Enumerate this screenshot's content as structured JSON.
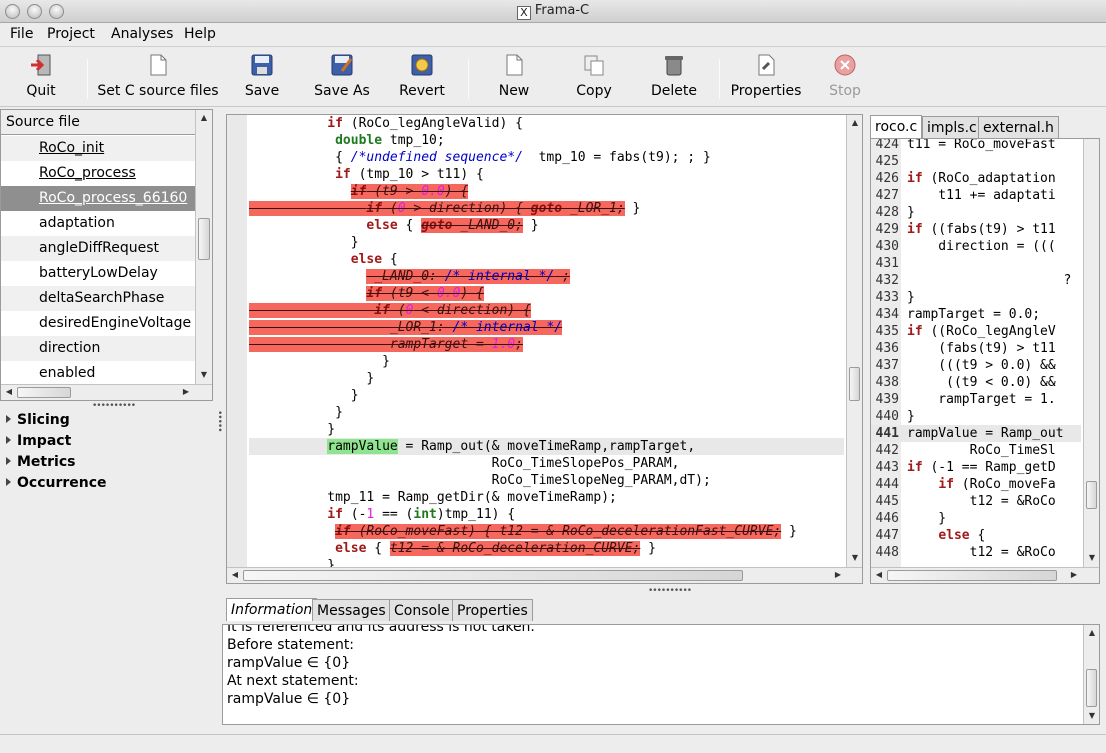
{
  "window": {
    "title": "Frama-C"
  },
  "menu": [
    "File",
    "Project",
    "Analyses",
    "Help"
  ],
  "toolbar": {
    "quit": "Quit",
    "set_sources": "Set C source files",
    "save": "Save",
    "save_as": "Save As",
    "revert": "Revert",
    "new": "New",
    "copy": "Copy",
    "delete": "Delete",
    "properties": "Properties",
    "stop": "Stop"
  },
  "file_panel": {
    "header": "Source file",
    "items": [
      "RoCo_init",
      "RoCo_process",
      "RoCo_process_66160",
      "adaptation",
      "angleDiffRequest",
      "batteryLowDelay",
      "deltaSearchPhase",
      "desiredEngineVoltage",
      "direction",
      "enabled"
    ],
    "selected_index": 2
  },
  "plugins": [
    "Slicing",
    "Impact",
    "Metrics",
    "Occurrence"
  ],
  "code": {
    "lines": [
      {
        "indent": "          ",
        "segs": [
          [
            "kw",
            "if"
          ],
          [
            "",
            " (RoCo_legAngleValid) {"
          ]
        ]
      },
      {
        "indent": "           ",
        "segs": [
          [
            "ty",
            "double"
          ],
          [
            "",
            " tmp_10;"
          ]
        ]
      },
      {
        "indent": "           ",
        "segs": [
          [
            "",
            "{ "
          ],
          [
            "cm",
            "/*undefined sequence*/"
          ],
          [
            "",
            "  tmp_10 = fabs(t9); ; }"
          ]
        ]
      },
      {
        "indent": "           ",
        "segs": [
          [
            "kw",
            "if"
          ],
          [
            "",
            " (tmp_10 > t11) {"
          ]
        ]
      },
      {
        "indent": "             ",
        "segs": [
          [
            "dead-kw",
            "if"
          ],
          [
            "dead",
            " (t9 > "
          ],
          [
            "dead-num",
            "0.0"
          ],
          [
            "dead",
            ") {"
          ]
        ]
      },
      {
        "indent": "",
        "segs": [
          [
            "dead",
            "               "
          ],
          [
            "dead-kw",
            "if"
          ],
          [
            "dead",
            " ("
          ],
          [
            "dead-num",
            "0"
          ],
          [
            "dead",
            " > direction) { "
          ],
          [
            "dead-kw",
            "goto"
          ],
          [
            "dead",
            " _LOR_1;"
          ],
          [
            "",
            " }"
          ]
        ]
      },
      {
        "indent": "               ",
        "segs": [
          [
            "kw",
            "else"
          ],
          [
            "",
            " { "
          ],
          [
            "dead-kw",
            "goto"
          ],
          [
            "dead",
            " _LAND_0;"
          ],
          [
            "",
            " }"
          ]
        ]
      },
      {
        "indent": "             ",
        "segs": [
          [
            "",
            "}"
          ]
        ]
      },
      {
        "indent": "             ",
        "segs": [
          [
            "kw",
            "else"
          ],
          [
            "",
            " {"
          ]
        ]
      },
      {
        "indent": "               ",
        "segs": [
          [
            "dead",
            " _LAND_0: "
          ],
          [
            "dead-cm",
            "/* internal */"
          ],
          [
            "dead",
            " ;"
          ]
        ]
      },
      {
        "indent": "               ",
        "segs": [
          [
            "dead-kw",
            "if"
          ],
          [
            "dead",
            " (t9 < "
          ],
          [
            "dead-num",
            "0.0"
          ],
          [
            "dead",
            ") {"
          ]
        ]
      },
      {
        "indent": "",
        "segs": [
          [
            "dead",
            "                "
          ],
          [
            "dead-kw",
            "if"
          ],
          [
            "dead",
            " ("
          ],
          [
            "dead-num",
            "0"
          ],
          [
            "dead",
            " < direction) {"
          ]
        ]
      },
      {
        "indent": "",
        "segs": [
          [
            "dead",
            "                  _LOR_1: "
          ],
          [
            "dead-cm",
            "/* internal */"
          ]
        ]
      },
      {
        "indent": "",
        "segs": [
          [
            "dead",
            "                  rampTarget = "
          ],
          [
            "dead-num",
            "1.0"
          ],
          [
            "dead",
            ";"
          ]
        ]
      },
      {
        "indent": "                 ",
        "segs": [
          [
            "",
            "}"
          ]
        ]
      },
      {
        "indent": "               ",
        "segs": [
          [
            "",
            "}"
          ]
        ]
      },
      {
        "indent": "             ",
        "segs": [
          [
            "",
            "}"
          ]
        ]
      },
      {
        "indent": "           ",
        "segs": [
          [
            "",
            "}"
          ]
        ]
      },
      {
        "indent": "          ",
        "segs": [
          [
            "",
            "}"
          ]
        ]
      },
      {
        "indent": "          ",
        "hl": true,
        "segs": [
          [
            "green",
            "rampValue"
          ],
          [
            "",
            " = Ramp_out(& moveTimeRamp,rampTarget,"
          ]
        ]
      },
      {
        "indent": "                               ",
        "segs": [
          [
            "",
            "RoCo_TimeSlopePos_PARAM,"
          ]
        ]
      },
      {
        "indent": "                               ",
        "segs": [
          [
            "",
            "RoCo_TimeSlopeNeg_PARAM,dT);"
          ]
        ]
      },
      {
        "indent": "          ",
        "segs": [
          [
            "",
            "tmp_11 = Ramp_getDir(& moveTimeRamp);"
          ]
        ]
      },
      {
        "indent": "          ",
        "segs": [
          [
            "kw",
            "if"
          ],
          [
            "",
            " (-"
          ],
          [
            "num",
            "1"
          ],
          [
            "",
            " == ("
          ],
          [
            "ty",
            "int"
          ],
          [
            "",
            ")tmp_11) {"
          ]
        ]
      },
      {
        "indent": "           ",
        "segs": [
          [
            "dead-kw",
            "if"
          ],
          [
            "dead",
            " (RoCo_moveFast) { t12 = & RoCo_decelerationFast_CURVE;"
          ],
          [
            "",
            " }"
          ]
        ]
      },
      {
        "indent": "           ",
        "segs": [
          [
            "kw",
            "else"
          ],
          [
            "",
            " { "
          ],
          [
            "dead",
            "t12 = & RoCo_deceleration_CURVE;"
          ],
          [
            "",
            " }"
          ]
        ]
      },
      {
        "indent": "          ",
        "segs": [
          [
            "",
            "}"
          ]
        ]
      }
    ]
  },
  "right_tabs": [
    "roco.c",
    "impls.c",
    "external.h"
  ],
  "right_code": {
    "lines": [
      {
        "n": "424",
        "t": "t11 = RoCo_moveFast"
      },
      {
        "n": "425",
        "t": ""
      },
      {
        "n": "426",
        "t": "if (RoCo_adaptation"
      },
      {
        "n": "427",
        "t": "    t11 += adaptati"
      },
      {
        "n": "428",
        "t": "}"
      },
      {
        "n": "429",
        "t": "if ((fabs(t9) > t11"
      },
      {
        "n": "430",
        "t": "    direction = ((("
      },
      {
        "n": "431",
        "t": ""
      },
      {
        "n": "432",
        "t": "                    ?"
      },
      {
        "n": "433",
        "t": "}"
      },
      {
        "n": "434",
        "t": "rampTarget = 0.0;"
      },
      {
        "n": "435",
        "t": "if ((RoCo_legAngleV"
      },
      {
        "n": "436",
        "t": "    (fabs(t9) > t11"
      },
      {
        "n": "437",
        "t": "    (((t9 > 0.0) &&"
      },
      {
        "n": "438",
        "t": "     ((t9 < 0.0) &&"
      },
      {
        "n": "439",
        "t": "    rampTarget = 1."
      },
      {
        "n": "440",
        "t": "}"
      },
      {
        "n": "441",
        "t": "rampValue = Ramp_out"
      },
      {
        "n": "442",
        "t": "        RoCo_TimeSl"
      },
      {
        "n": "443",
        "t": "if (-1 == Ramp_getD"
      },
      {
        "n": "444",
        "t": "    if (RoCo_moveFa"
      },
      {
        "n": "445",
        "t": "        t12 = &RoCo"
      },
      {
        "n": "446",
        "t": "    }"
      },
      {
        "n": "447",
        "t": "    else {"
      },
      {
        "n": "448",
        "t": "        t12 = &RoCo"
      }
    ],
    "current": "441"
  },
  "bottom_tabs": [
    "Information",
    "Messages",
    "Console",
    "Properties"
  ],
  "info": {
    "lines": [
      "It is referenced and its address is not taken.",
      "Before statement:",
      "rampValue ∈ {0}",
      "At next statement:",
      "rampValue ∈ {0}"
    ]
  }
}
